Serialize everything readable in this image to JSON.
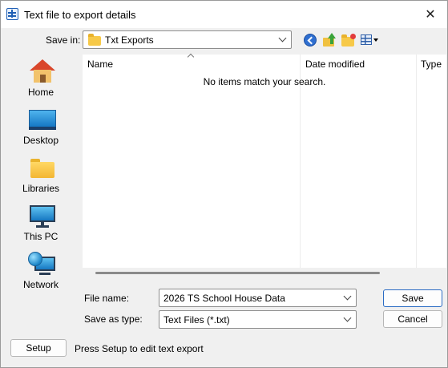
{
  "window": {
    "title": "Text file to export details"
  },
  "toolbar": {
    "save_in_label": "Save in:",
    "save_in_value": "Txt Exports"
  },
  "places": [
    {
      "label": "Home",
      "icon": "home-icon"
    },
    {
      "label": "Desktop",
      "icon": "desktop-icon"
    },
    {
      "label": "Libraries",
      "icon": "libraries-icon"
    },
    {
      "label": "This PC",
      "icon": "this-pc-icon"
    },
    {
      "label": "Network",
      "icon": "network-icon"
    }
  ],
  "filelist": {
    "columns": [
      "Name",
      "Date modified",
      "Type"
    ],
    "empty_message": "No items match your search."
  },
  "form": {
    "file_name_label": "File name:",
    "file_name_value": "2026 TS School House Data",
    "save_type_label": "Save as type:",
    "save_type_value": "Text Files (*.txt)"
  },
  "buttons": {
    "save": "Save",
    "cancel": "Cancel",
    "setup": "Setup"
  },
  "setup_hint": "Press Setup to edit text export",
  "colors": {
    "default_button_border": "#2b6cc4",
    "dialog_background": "#f0f0f0"
  }
}
